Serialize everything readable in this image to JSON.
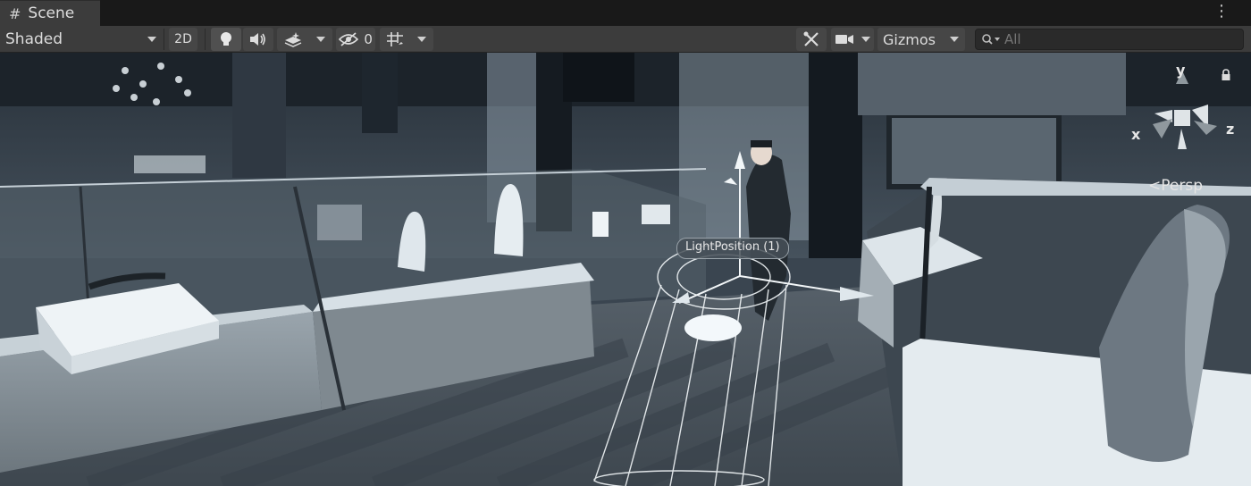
{
  "tab": {
    "title": "Scene",
    "icon": "hash-icon"
  },
  "toolbar": {
    "shading_mode": "Shaded",
    "mode_2d": "2D",
    "hidden_count": "0",
    "gizmos_label": "Gizmos",
    "search_placeholder": "All"
  },
  "viewport": {
    "orientation": {
      "y": "y",
      "x": "x",
      "z": "z",
      "projection": "Persp"
    },
    "selected_object_label": "LightPosition (1)"
  }
}
